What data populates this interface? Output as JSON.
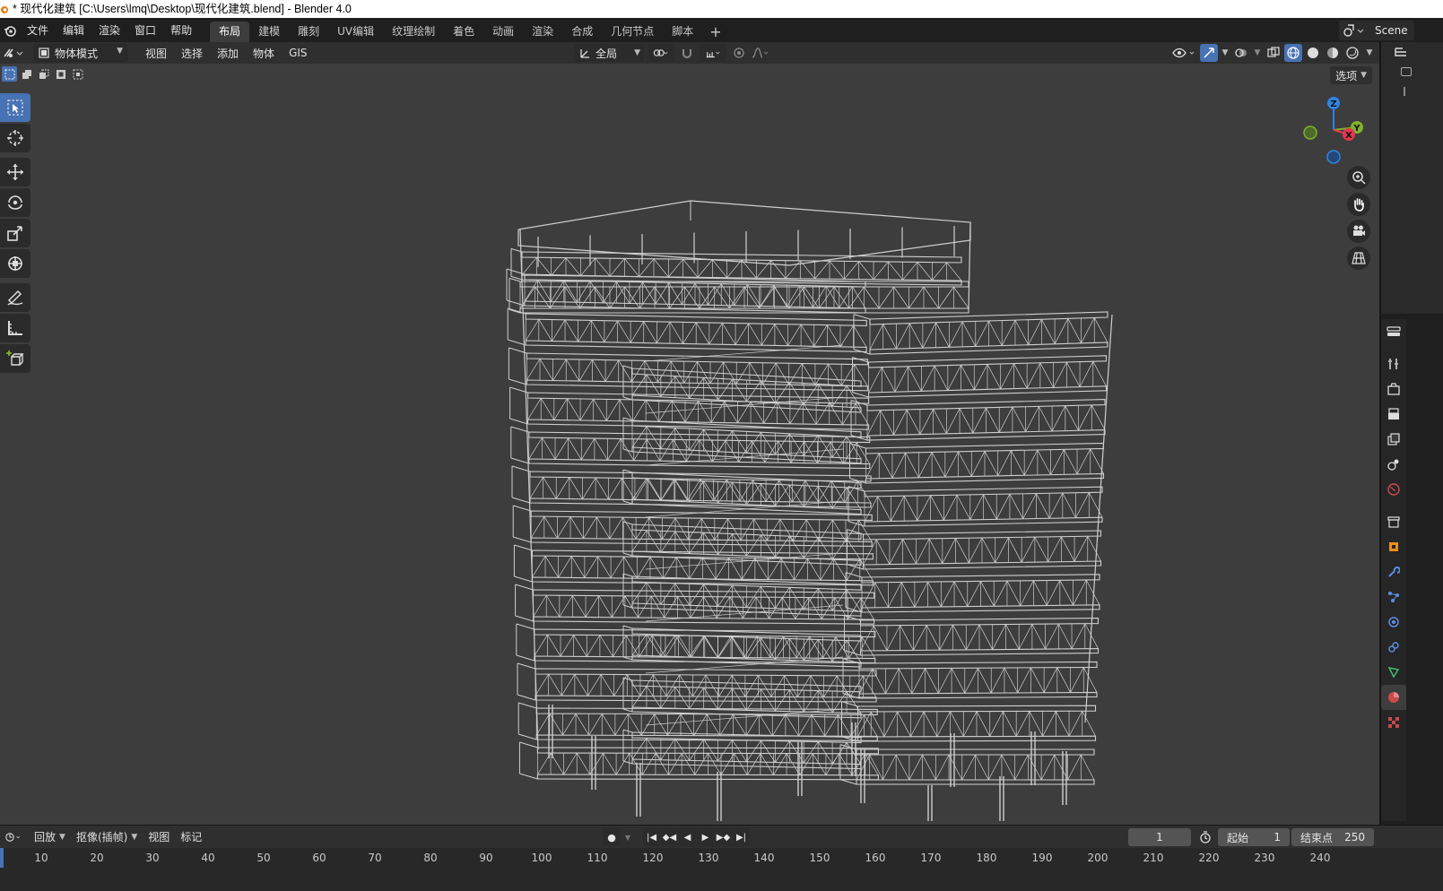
{
  "window": {
    "title": "* 现代化建筑 [C:\\Users\\lmq\\Desktop\\现代化建筑.blend] - Blender 4.0"
  },
  "menubar": {
    "items": [
      "文件",
      "编辑",
      "渲染",
      "窗口",
      "帮助"
    ],
    "workspaces": [
      "布局",
      "建模",
      "雕刻",
      "UV编辑",
      "纹理绘制",
      "着色",
      "动画",
      "渲染",
      "合成",
      "几何节点",
      "脚本"
    ],
    "active_workspace": "布局",
    "add_label": "+",
    "scene_label": "Scene"
  },
  "viewport_header": {
    "mode": "物体模式",
    "menus": [
      "视图",
      "选择",
      "添加",
      "物体",
      "GIS"
    ],
    "orientation": "全局",
    "options_label": "选项"
  },
  "gizmo": {
    "axis_z": "Z",
    "axis_y": "Y",
    "axis_x": "X",
    "color_x": "#e5354f",
    "color_y": "#7fb12b",
    "color_z": "#2f84e3"
  },
  "tools": [
    "select-box",
    "cursor",
    "move",
    "rotate",
    "scale",
    "transform",
    "annotate",
    "measure",
    "add-cube"
  ],
  "timeline": {
    "playback": "回放",
    "keying": "抠像(插帧)",
    "view": "视图",
    "markers": "标记",
    "current_frame": "1",
    "start_label": "起始",
    "start_value": "1",
    "end_label": "结束点",
    "end_value": "250",
    "ruler_ticks": [
      "10",
      "20",
      "30",
      "40",
      "50",
      "60",
      "70",
      "80",
      "90",
      "100",
      "110",
      "120",
      "130",
      "140",
      "150",
      "160",
      "170",
      "180",
      "190",
      "200",
      "210",
      "220",
      "230",
      "240"
    ]
  },
  "colors": {
    "accent": "#4772b3",
    "viewport_bg": "#3d3d3d",
    "wire": "#cfcfcf"
  }
}
